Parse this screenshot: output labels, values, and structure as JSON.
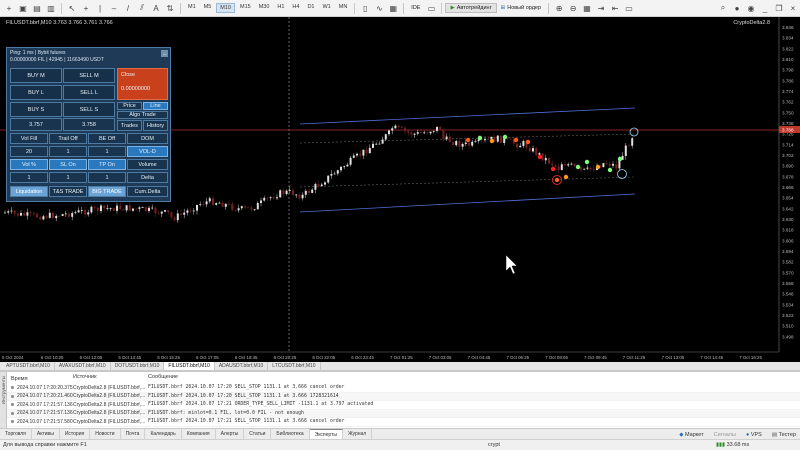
{
  "toolbar": {
    "timeframes": [
      "M1",
      "M5",
      "M10",
      "M15",
      "M30",
      "H1",
      "H4",
      "D1",
      "W1",
      "MN"
    ],
    "active_timeframe": "M10",
    "ide_label": "IDE",
    "algo_label": "Автотрейдинг",
    "new_order_label": "Новый ордер"
  },
  "chart": {
    "symbol_info": "FILUSDT.bbrf,M10 3.763 3.766 3.761 3.766",
    "indicator_name": "CryptoDelta2.8",
    "price_labels": [
      "3.846",
      "3.834",
      "3.822",
      "3.810",
      "3.798",
      "3.786",
      "3.774",
      "3.762",
      "3.750",
      "3.738",
      "3.726",
      "3.714",
      "3.702",
      "3.690",
      "3.678",
      "3.666",
      "3.654",
      "3.642",
      "3.630",
      "3.618",
      "3.606",
      "3.594",
      "3.582",
      "3.570",
      "3.558",
      "3.546",
      "3.534",
      "3.522",
      "3.510",
      "3.498"
    ],
    "current_price": "3.766",
    "time_labels": [
      "5 Oct 2024",
      "6 Oct 10:25",
      "6 Oct 12:05",
      "6 Oct 13:45",
      "6 Oct 15:25",
      "6 Oct 17:05",
      "6 Oct 18:45",
      "6 Oct 20:25",
      "6 Oct 22:05",
      "6 Oct 23:45",
      "7 Oct 01:25",
      "7 Oct 03:05",
      "7 Oct 04:45",
      "7 Oct 06:25",
      "7 Oct 08:05",
      "7 Oct 09:45",
      "7 Oct 11:25",
      "7 Oct 13:05",
      "7 Oct 14:45",
      "7 Oct 16:25"
    ]
  },
  "panel": {
    "title": "Ping: 1 ms | Bybit futures",
    "balance": "0.00000000 FIL | 42945 | 11663490 USDT",
    "buy_m": "BUY M",
    "sell_m": "SELL M",
    "buy_l": "BUY L",
    "sell_l": "SELL L",
    "buy_s": "BUY S",
    "sell_s": "SELL S",
    "close": "Close",
    "close_value": "0.00000000",
    "bid": "3.757",
    "ask": "3.758",
    "price": "Price",
    "line": "Line",
    "algo_trade": "Algo Trade",
    "trades": "Trades",
    "history": "History",
    "vol_fill": "Vol Fill",
    "trail_off": "Trail Off",
    "be_off": "BE Off",
    "dom": "DOM",
    "val1": "20",
    "val2": "1",
    "val3": "1",
    "vol_d": "VOL-D",
    "vol_pct": "Vol %",
    "sl_on": "SL On",
    "tp_on": "TP On",
    "volume": "Volume",
    "val4": "1",
    "val5": "1",
    "val6": "1",
    "delta": "Delta",
    "liquidation": "Liquidation",
    "tas_trade": "T&S TRADE",
    "big_trade": "BIG TRADE",
    "cum_delta": "Cum.Delta"
  },
  "chart_tabs": [
    "APTUSDT.bbrf,M10",
    "AVAXUSDT.bbrf,M10",
    "DOTUSDT.bbrf,M10",
    "FILUSDT.bbrf,M10",
    "ADAUSDT.bbrf,M10",
    "LTCUSDT.bbrf,M10"
  ],
  "active_chart_tab": "FILUSDT.bbrf,M10",
  "terminal": {
    "side_label": "Инструменты",
    "headers": {
      "time": "Время",
      "source": "Источник",
      "message": "Сообщение"
    },
    "rows": [
      {
        "time": "2024.10.07 17:20:20.375",
        "source": "CryptoDelta2.8 (FILUSDT.bbrf,...",
        "message": "FILUSDT.bbrf 2024.10.07 17:20 SELL_STOP 1131.1 at 3.666 cancel order"
      },
      {
        "time": "2024.10.07 17:20:21.460",
        "source": "CryptoDelta2.8 (FILUSDT.bbrf,...",
        "message": "FILUSDT.bbrf 2024.10.07 17:20 SELL_STOP 1131.1 at 3.666 1728321614"
      },
      {
        "time": "2024.10.07 17:21:57.136",
        "source": "CryptoDelta2.8 (FILUSDT.bbrf,...",
        "message": "FILUSDT.bbrf 2024.10.07 17:21 ORDER_TYPE_SELL_LIMIT -1131.1 at 3.797 activated"
      },
      {
        "time": "2024.10.07 17:21:57.136",
        "source": "CryptoDelta2.8 (FILUSDT.bbrf,...",
        "message": "FILUSDT.bbrf: minlot=0.1 FIL, lot=0.0 FIL - not enough"
      },
      {
        "time": "2024.10.07 17:21:57.580",
        "source": "CryptoDelta2.8 (FILUSDT.bbrf,...",
        "message": "FILUSDT.bbrf 2024.10.07 17:21 SELL_STOP 1131.1 at 3.666 cancel order"
      }
    ]
  },
  "bottom_tabs": [
    "Торговля",
    "Активы",
    "История",
    "Новости",
    "Почта",
    "Календарь",
    "Компания",
    "Алерты",
    "Статьи",
    "Библиотека",
    "Эксперты",
    "Журнал"
  ],
  "active_bottom_tab": "Эксперты",
  "bottom_right": {
    "market": "Маркет",
    "signals": "Сигналы",
    "vps": "VPS",
    "tester": "Тестер"
  },
  "statusbar": {
    "help": "Для вывода справки нажмите F1",
    "profile": "crypt",
    "ping": "33.68 ms"
  }
}
